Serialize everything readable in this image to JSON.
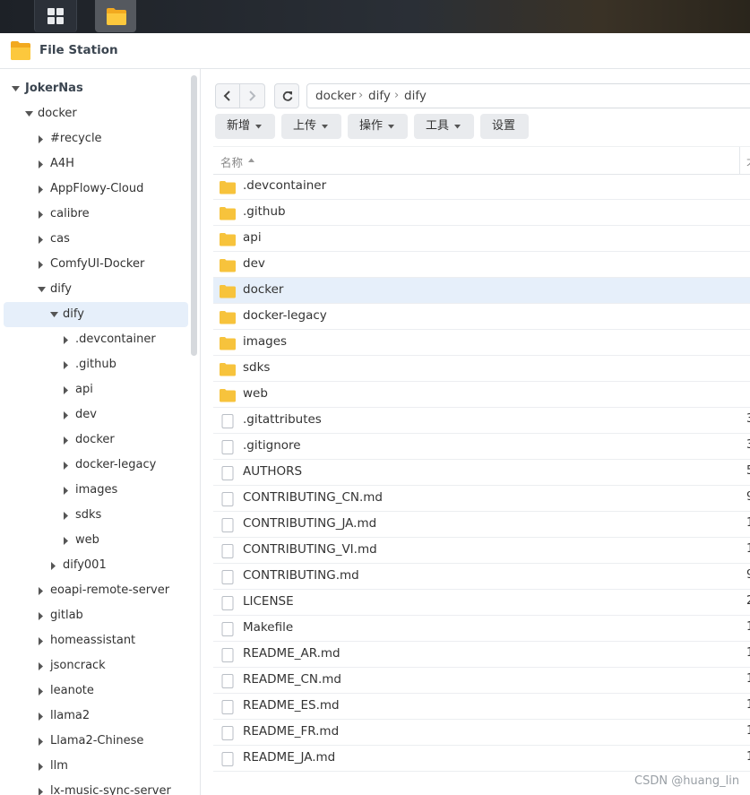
{
  "app": {
    "title": "File Station"
  },
  "sidebar": {
    "root": "JokerNas",
    "nodes": [
      {
        "label": "docker",
        "depth": 1,
        "open": true
      },
      {
        "label": "#recycle",
        "depth": 2
      },
      {
        "label": "A4H",
        "depth": 2
      },
      {
        "label": "AppFlowy-Cloud",
        "depth": 2
      },
      {
        "label": "calibre",
        "depth": 2
      },
      {
        "label": "cas",
        "depth": 2
      },
      {
        "label": "ComfyUI-Docker",
        "depth": 2
      },
      {
        "label": "dify",
        "depth": 2,
        "open": true
      },
      {
        "label": "dify",
        "depth": 3,
        "open": true,
        "selected": true
      },
      {
        "label": ".devcontainer",
        "depth": 4
      },
      {
        "label": ".github",
        "depth": 4
      },
      {
        "label": "api",
        "depth": 4
      },
      {
        "label": "dev",
        "depth": 4
      },
      {
        "label": "docker",
        "depth": 4
      },
      {
        "label": "docker-legacy",
        "depth": 4
      },
      {
        "label": "images",
        "depth": 4
      },
      {
        "label": "sdks",
        "depth": 4
      },
      {
        "label": "web",
        "depth": 4
      },
      {
        "label": "dify001",
        "depth": 3
      },
      {
        "label": "eoapi-remote-server",
        "depth": 2
      },
      {
        "label": "gitlab",
        "depth": 2
      },
      {
        "label": "homeassistant",
        "depth": 2
      },
      {
        "label": "jsoncrack",
        "depth": 2
      },
      {
        "label": "leanote",
        "depth": 2
      },
      {
        "label": "llama2",
        "depth": 2
      },
      {
        "label": "Llama2-Chinese",
        "depth": 2
      },
      {
        "label": "llm",
        "depth": 2
      },
      {
        "label": "lx-music-sync-server",
        "depth": 2
      }
    ]
  },
  "path": {
    "crumbs": [
      "docker",
      "dify",
      "dify"
    ],
    "separator": "›"
  },
  "toolbar": {
    "new_label": "新增",
    "upload_label": "上传",
    "action_label": "操作",
    "tools_label": "工具",
    "settings_label": "设置"
  },
  "list": {
    "header_name": "名称",
    "header_next": "大",
    "rows": [
      {
        "name": ".devcontainer",
        "type": "folder",
        "size": ""
      },
      {
        "name": ".github",
        "type": "folder",
        "size": ""
      },
      {
        "name": "api",
        "type": "folder",
        "size": ""
      },
      {
        "name": "dev",
        "type": "folder",
        "size": ""
      },
      {
        "name": "docker",
        "type": "folder",
        "size": "",
        "selected": true
      },
      {
        "name": "docker-legacy",
        "type": "folder",
        "size": ""
      },
      {
        "name": "images",
        "type": "folder",
        "size": ""
      },
      {
        "name": "sdks",
        "type": "folder",
        "size": ""
      },
      {
        "name": "web",
        "type": "folder",
        "size": ""
      },
      {
        "name": ".gitattributes",
        "type": "file",
        "size": "3"
      },
      {
        "name": ".gitignore",
        "type": "file",
        "size": "3"
      },
      {
        "name": "AUTHORS",
        "type": "file",
        "size": "5"
      },
      {
        "name": "CONTRIBUTING_CN.md",
        "type": "file",
        "size": "9"
      },
      {
        "name": "CONTRIBUTING_JA.md",
        "type": "file",
        "size": "1"
      },
      {
        "name": "CONTRIBUTING_VI.md",
        "type": "file",
        "size": "1"
      },
      {
        "name": "CONTRIBUTING.md",
        "type": "file",
        "size": "9"
      },
      {
        "name": "LICENSE",
        "type": "file",
        "size": "2"
      },
      {
        "name": "Makefile",
        "type": "file",
        "size": "1"
      },
      {
        "name": "README_AR.md",
        "type": "file",
        "size": "1"
      },
      {
        "name": "README_CN.md",
        "type": "file",
        "size": "1"
      },
      {
        "name": "README_ES.md",
        "type": "file",
        "size": "1"
      },
      {
        "name": "README_FR.md",
        "type": "file",
        "size": "1"
      },
      {
        "name": "README_JA.md",
        "type": "file",
        "size": "1"
      }
    ]
  },
  "watermark": "CSDN @huang_lin",
  "colors": {
    "folder": "#f7c33c",
    "selection": "#e6effa",
    "taskbar": "#1d2127"
  },
  "icons": {
    "desktop": "grid-icon",
    "file_station": "folder-icon"
  }
}
